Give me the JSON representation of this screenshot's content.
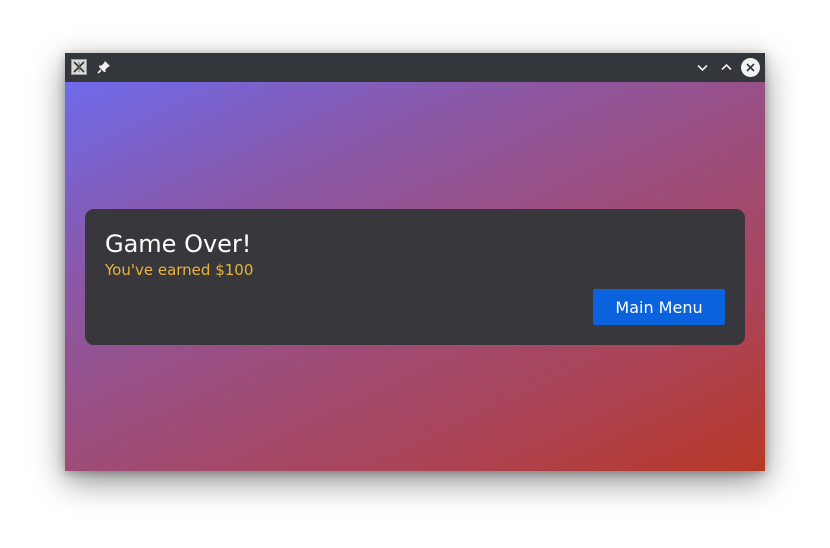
{
  "window": {
    "app_icon": "x-app-icon",
    "pin_icon": "pin-icon",
    "controls": [
      "minimize-chevron-down-icon",
      "maximize-chevron-up-icon",
      "close-icon"
    ]
  },
  "dialog": {
    "title": "Game Over!",
    "subtitle": "You've earned $100",
    "button_label": "Main Menu"
  },
  "colors": {
    "gradient_start": "#6e6aea",
    "gradient_end": "#b83826",
    "card_bg": "#38383c",
    "subtitle": "#e8b43a",
    "button": "#0b62dd"
  }
}
